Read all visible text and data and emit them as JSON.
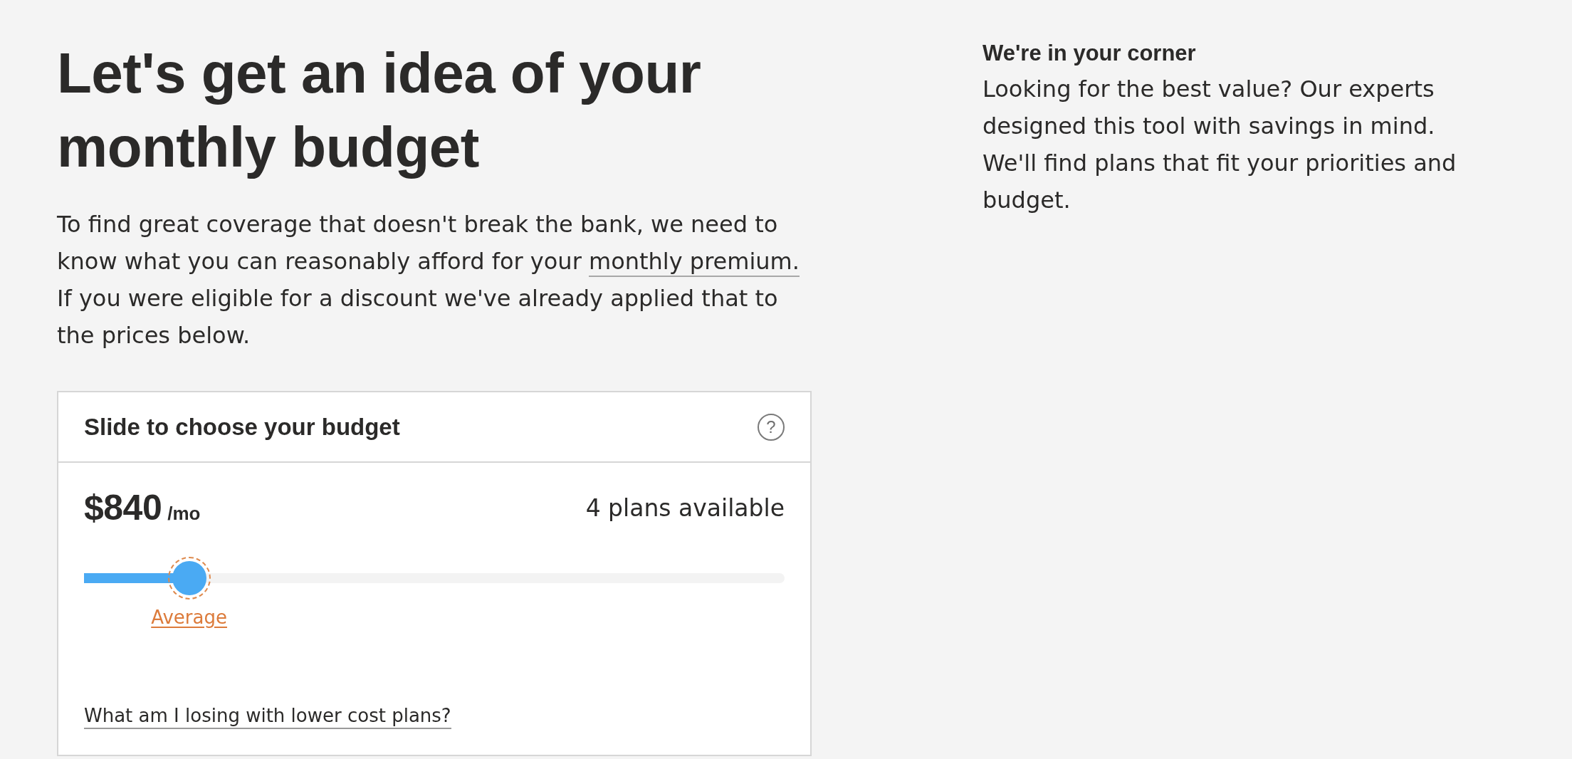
{
  "heading": "Let's get an idea of your monthly budget",
  "intro": {
    "before": "To find great coverage that doesn't break the bank, we need to know what you can reasonably afford for your",
    "link": "monthly premium.",
    "after": "If you were eligible for a discount we've already applied that to the prices below."
  },
  "budget_card": {
    "title": "Slide to choose your budget",
    "help": "?",
    "price": "$840",
    "unit": "/mo",
    "plans": "4 plans available",
    "slider": {
      "level": 0.15
    },
    "marker": "Average",
    "link": "What am I losing with lower cost plans?"
  },
  "aside": {
    "title": "We're in your corner",
    "text": "Looking for the best value? Our experts designed this tool with savings in mind. We'll find plans that fit your priorities and budget."
  }
}
